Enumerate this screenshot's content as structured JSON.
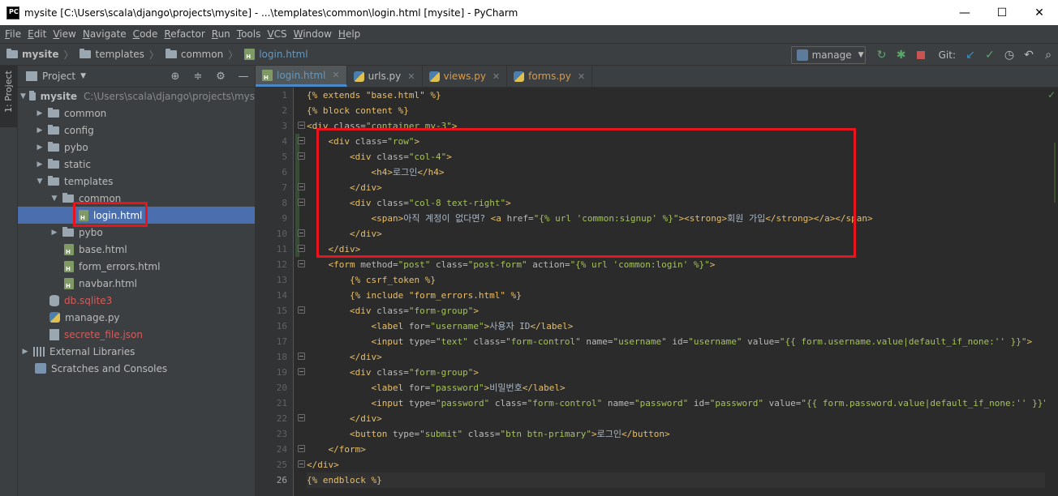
{
  "window": {
    "title": "mysite [C:\\Users\\scala\\django\\projects\\mysite] - ...\\templates\\common\\login.html [mysite] - PyCharm",
    "logo": "PC",
    "minimize": "—",
    "maximize": "☐",
    "close": "✕"
  },
  "menu": [
    {
      "label": "File",
      "mnemonic": "F",
      "rest": "ile"
    },
    {
      "label": "Edit",
      "mnemonic": "E",
      "rest": "dit"
    },
    {
      "label": "View",
      "mnemonic": "V",
      "rest": "iew"
    },
    {
      "label": "Navigate",
      "mnemonic": "N",
      "rest": "avigate"
    },
    {
      "label": "Code",
      "mnemonic": "C",
      "rest": "ode"
    },
    {
      "label": "Refactor",
      "mnemonic": "R",
      "rest": "efactor"
    },
    {
      "label": "Run",
      "mnemonic": "R",
      "rest": "un"
    },
    {
      "label": "Tools",
      "mnemonic": "T",
      "rest": "ools"
    },
    {
      "label": "VCS",
      "mnemonic": "V",
      "rest": "CS"
    },
    {
      "label": "Window",
      "mnemonic": "W",
      "rest": "indow"
    },
    {
      "label": "Help",
      "mnemonic": "H",
      "rest": "elp"
    }
  ],
  "breadcrumb": {
    "project": "mysite",
    "folder1": "templates",
    "folder2": "common",
    "file": "login.html"
  },
  "toolbar": {
    "run_config": "manage",
    "git_label": "Git:"
  },
  "side_tab": "1: Project",
  "project_panel": {
    "title": "Project",
    "root_name": "mysite",
    "root_path": "C:\\Users\\scala\\django\\projects\\mys",
    "items": {
      "common": "common",
      "config": "config",
      "pybo": "pybo",
      "static": "static",
      "templates": "templates",
      "templates_common": "common",
      "login": "login.html",
      "templates_pybo": "pybo",
      "base": "base.html",
      "form_errors": "form_errors.html",
      "navbar": "navbar.html",
      "db": "db.sqlite3",
      "manage": "manage.py",
      "secrete": "secrete_file.json",
      "external": "External Libraries",
      "scratches": "Scratches and Consoles"
    }
  },
  "tabs": [
    {
      "label": "login.html"
    },
    {
      "label": "urls.py"
    },
    {
      "label": "views.py"
    },
    {
      "label": "forms.py"
    }
  ],
  "code": {
    "current_line": 26
  },
  "highlight_color": "#e8141e"
}
